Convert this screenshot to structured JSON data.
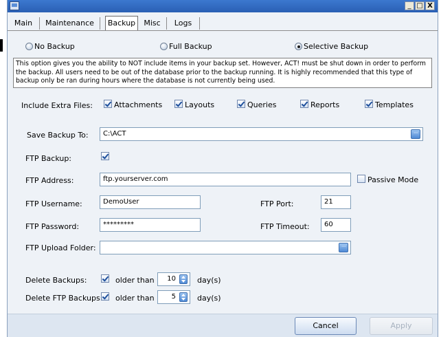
{
  "window": {
    "minimize": "_",
    "maximize": "□",
    "close": "X"
  },
  "tabs": [
    {
      "label": "Main",
      "active": false
    },
    {
      "label": "Maintenance",
      "active": false
    },
    {
      "label": "Backup",
      "active": true
    },
    {
      "label": "Misc",
      "active": false
    },
    {
      "label": "Logs",
      "active": false
    }
  ],
  "backup_mode": {
    "options": [
      "No Backup",
      "Full Backup",
      "Selective Backup"
    ],
    "selected": "Selective Backup"
  },
  "description": "This option gives you the ability to NOT include items in your backup set.  However, ACT! must be shut down in order to perform the backup.  All users need to be out of the database prior to the backup running.  It is highly recommended that this type of backup only be ran during hours where the database is not currently being used.",
  "extra_files": {
    "label": "Include Extra Files:",
    "items": [
      {
        "label": "Attachments",
        "checked": true
      },
      {
        "label": "Layouts",
        "checked": true
      },
      {
        "label": "Queries",
        "checked": true
      },
      {
        "label": "Reports",
        "checked": true
      },
      {
        "label": "Templates",
        "checked": true
      }
    ]
  },
  "save_backup": {
    "label": "Save Backup To:",
    "value": "C:\\ACT",
    "browse": "···"
  },
  "ftp_backup": {
    "label": "FTP Backup:",
    "checked": true
  },
  "ftp_address": {
    "label": "FTP Address:",
    "value": "ftp.yourserver.com"
  },
  "passive_mode": {
    "label": "Passive Mode",
    "checked": false
  },
  "ftp_username": {
    "label": "FTP Username:",
    "value": "DemoUser"
  },
  "ftp_port": {
    "label": "FTP Port:",
    "value": "21"
  },
  "ftp_password": {
    "label": "FTP Password:",
    "value": "*********"
  },
  "ftp_timeout": {
    "label": "FTP Timeout:",
    "value": "60"
  },
  "ftp_upload_folder": {
    "label": "FTP Upload Folder:",
    "value": "",
    "browse": "···"
  },
  "delete_backups": {
    "label": "Delete Backups:",
    "checked": true,
    "older_than": "older than",
    "value": "10",
    "unit": "day(s)"
  },
  "delete_ftp_backups": {
    "label": "Delete FTP Backups:",
    "checked": true,
    "older_than": "older than",
    "value": "5",
    "unit": "day(s)"
  },
  "footer": {
    "cancel": "Cancel",
    "apply": "Apply"
  }
}
